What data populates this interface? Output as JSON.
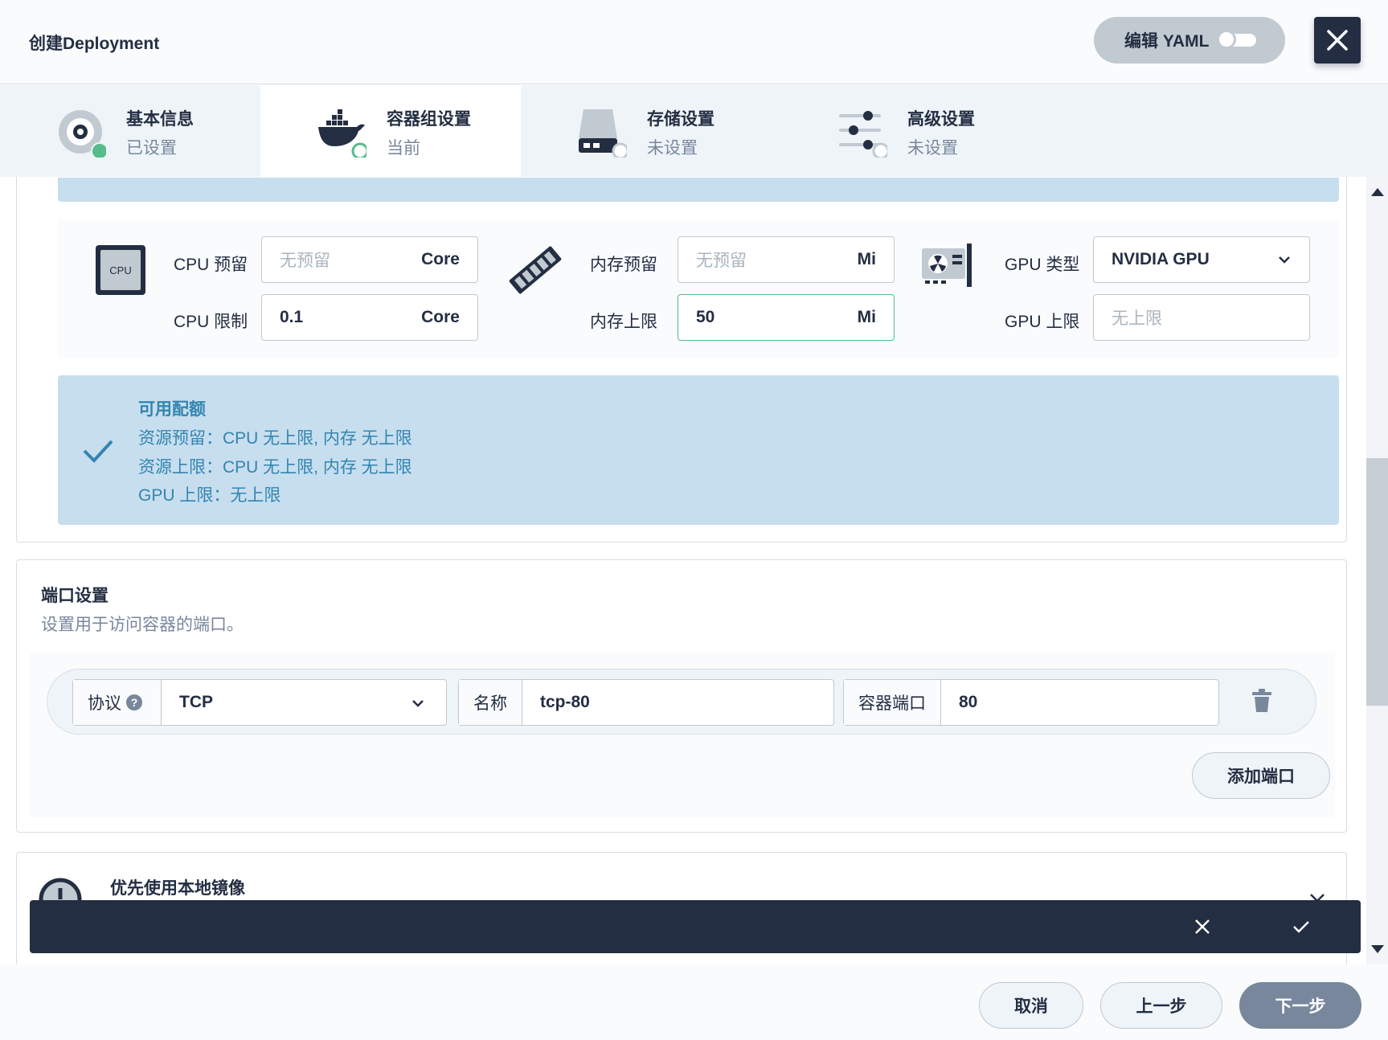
{
  "header": {
    "title": "创建Deployment",
    "yaml_label": "编辑 YAML"
  },
  "steps": [
    {
      "title": "基本信息",
      "status": "已设置"
    },
    {
      "title": "容器组设置",
      "status": "当前"
    },
    {
      "title": "存储设置",
      "status": "未设置"
    },
    {
      "title": "高级设置",
      "status": "未设置"
    }
  ],
  "resources": {
    "cpu_icon_text": "CPU",
    "cpu_request_label": "CPU 预留",
    "cpu_request_placeholder": "无预留",
    "cpu_limit_label": "CPU 限制",
    "cpu_limit_value": "0.1",
    "cpu_unit": "Core",
    "mem_request_label": "内存预留",
    "mem_request_placeholder": "无预留",
    "mem_limit_label": "内存上限",
    "mem_limit_value": "50",
    "mem_unit": "Mi",
    "gpu_type_label": "GPU 类型",
    "gpu_type_value": "NVIDIA GPU",
    "gpu_limit_label": "GPU 上限",
    "gpu_limit_placeholder": "无上限"
  },
  "quota": {
    "title": "可用配额",
    "lines": [
      "资源预留：CPU 无上限, 内存 无上限",
      "资源上限：CPU 无上限, 内存 无上限",
      "GPU 上限：无上限"
    ]
  },
  "ports": {
    "title": "端口设置",
    "description": "设置用于访问容器的端口。",
    "protocol_label": "协议",
    "protocol_value": "TCP",
    "name_label": "名称",
    "name_value": "tcp-80",
    "port_label": "容器端口",
    "port_value": "80",
    "add_label": "添加端口"
  },
  "local_image": {
    "title": "优先使用本地镜像"
  },
  "footer": {
    "cancel": "取消",
    "prev": "上一步",
    "next": "下一步"
  },
  "colors": {
    "accent_green": "#55bc8a",
    "dark": "#242e42",
    "info_blue": "#3385b0",
    "info_bg": "#c7deef"
  }
}
